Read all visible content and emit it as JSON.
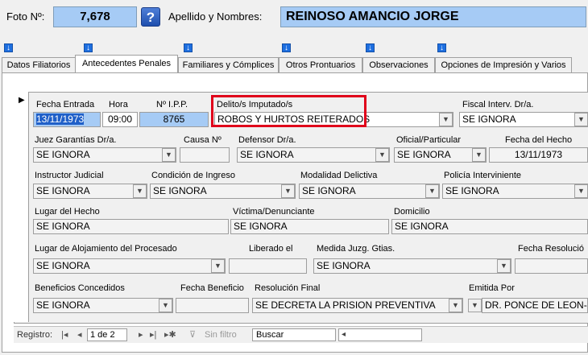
{
  "header": {
    "foto_label": "Foto Nº:",
    "foto_value": "7,678",
    "help_glyph": "?",
    "name_label": "Apellido y Nombres:",
    "name_value": "REINOSO AMANCIO JORGE"
  },
  "tabs": [
    "Datos Filiatorios",
    "Antecedentes Penales",
    "Familiares y Cómplices",
    "Otros Prontuarios",
    "Observaciones",
    "Opciones de Impresión y Varios"
  ],
  "record": {
    "fecha_entrada_label": "Fecha Entrada",
    "fecha_entrada": "13/11/1973",
    "hora_label": "Hora",
    "hora": "09:00",
    "ipp_label": "Nº I.P.P.",
    "ipp": "8765",
    "delito_label": "Delito/s Imputado/s",
    "delito": "ROBOS Y HURTOS REITERADOS",
    "fiscal_label": "Fiscal Interv. Dr/a.",
    "fiscal": "SE IGNORA",
    "juez_label": "Juez Garantías Dr/a.",
    "juez": "SE IGNORA",
    "causa_label": "Causa Nº",
    "causa": "",
    "defensor_label": "Defensor Dr/a.",
    "defensor": "SE IGNORA",
    "oficial_label": "Oficial/Particular",
    "oficial": "SE IGNORA",
    "fecha_hecho_label": "Fecha del Hecho",
    "fecha_hecho": "13/11/1973",
    "instructor_label": "Instructor Judicial",
    "instructor": "SE IGNORA",
    "condicion_label": "Condición de Ingreso",
    "condicion": "SE IGNORA",
    "modalidad_label": "Modalidad Delictiva",
    "modalidad": "SE IGNORA",
    "policia_label": "Policía Interviniente",
    "policia": "SE IGNORA",
    "lugar_hecho_label": "Lugar del Hecho",
    "lugar_hecho": "SE IGNORA",
    "victima_label": "Víctima/Denunciante",
    "victima": "SE IGNORA",
    "domicilio_label": "Domicilio",
    "domicilio": "SE IGNORA",
    "alojamiento_label": "Lugar de Alojamiento del Procesado",
    "alojamiento": "SE IGNORA",
    "liberado_label": "Liberado el",
    "liberado": "",
    "medida_label": "Medida Juzg. Gtias.",
    "medida": "SE IGNORA",
    "fecha_resolucion_label": "Fecha Resolució",
    "beneficios_label": "Beneficios Concedidos",
    "beneficios": "SE IGNORA",
    "fecha_beneficio_label": "Fecha Beneficio",
    "fecha_beneficio": "",
    "resolucion_label": "Resolución Final",
    "resolucion": "SE DECRETA LA PRISION PREVENTIVA",
    "emitida_label": "Emitida Por",
    "emitida": "DR. PONCE DE LEON-JU"
  },
  "navbar": {
    "registro_label": "Registro:",
    "record_position": "1 de 2",
    "filter_label": "Sin filtro",
    "search_label": "Buscar"
  },
  "colors": {
    "highlight_border": "#e0001a",
    "blue_field": "#a6cbf5",
    "tab_arrow": "#1e6fe0"
  }
}
